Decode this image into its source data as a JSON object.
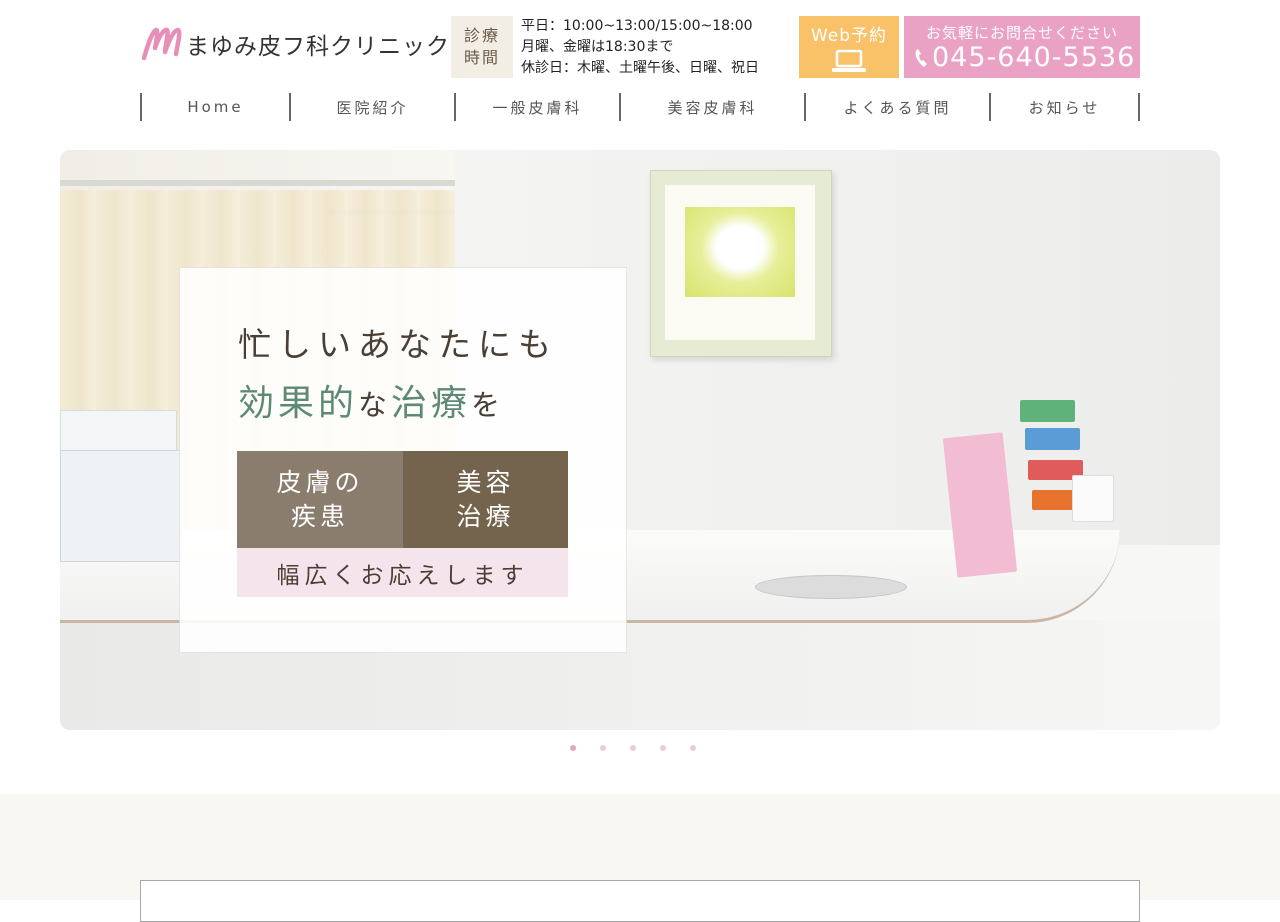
{
  "header": {
    "clinic_name": "まゆみ皮フ科クリニック",
    "logo_icon": "m-script-logo-icon",
    "hours_label_line1": "診療",
    "hours_label_line2": "時間",
    "hours_line1": "平日：10:00~13:00/15:00~18:00",
    "hours_line2": "月曜、金曜は18:30まで",
    "hours_line3": "休診日：木曜、土曜午後、日曜、祝日",
    "web_label": "Web予約",
    "web_icon": "laptop-icon",
    "tel_top": "お気軽にお問合せください",
    "tel_icon": "phone-icon",
    "tel_number": "045-640-5536",
    "colors": {
      "web_bg": "#f9c168",
      "tel_bg": "#eaa2c4",
      "hours_bg": "#f2eee6"
    }
  },
  "nav": {
    "items": [
      {
        "label": "Home"
      },
      {
        "label": "医院紹介"
      },
      {
        "label": "一般皮膚科"
      },
      {
        "label": "美容皮膚科"
      },
      {
        "label": "よくある質問"
      },
      {
        "label": "お知らせ"
      }
    ]
  },
  "hero": {
    "line1": "忙しいあなたにも",
    "line2_part1": "効果的",
    "line2_part2": "な",
    "line2_part3": "治療",
    "line2_part4": "を",
    "box1_line1": "皮膚の",
    "box1_line2": "疾患",
    "box2_line1": "美容",
    "box2_line2": "治療",
    "bar": "幅広くお応えします",
    "colors": {
      "accent_green": "#5e8a74",
      "box1": "#8a7d6e",
      "box2": "#74644e",
      "bar": "#f4e4ec"
    }
  },
  "slider": {
    "dot_count": 5,
    "active_index": 0
  }
}
